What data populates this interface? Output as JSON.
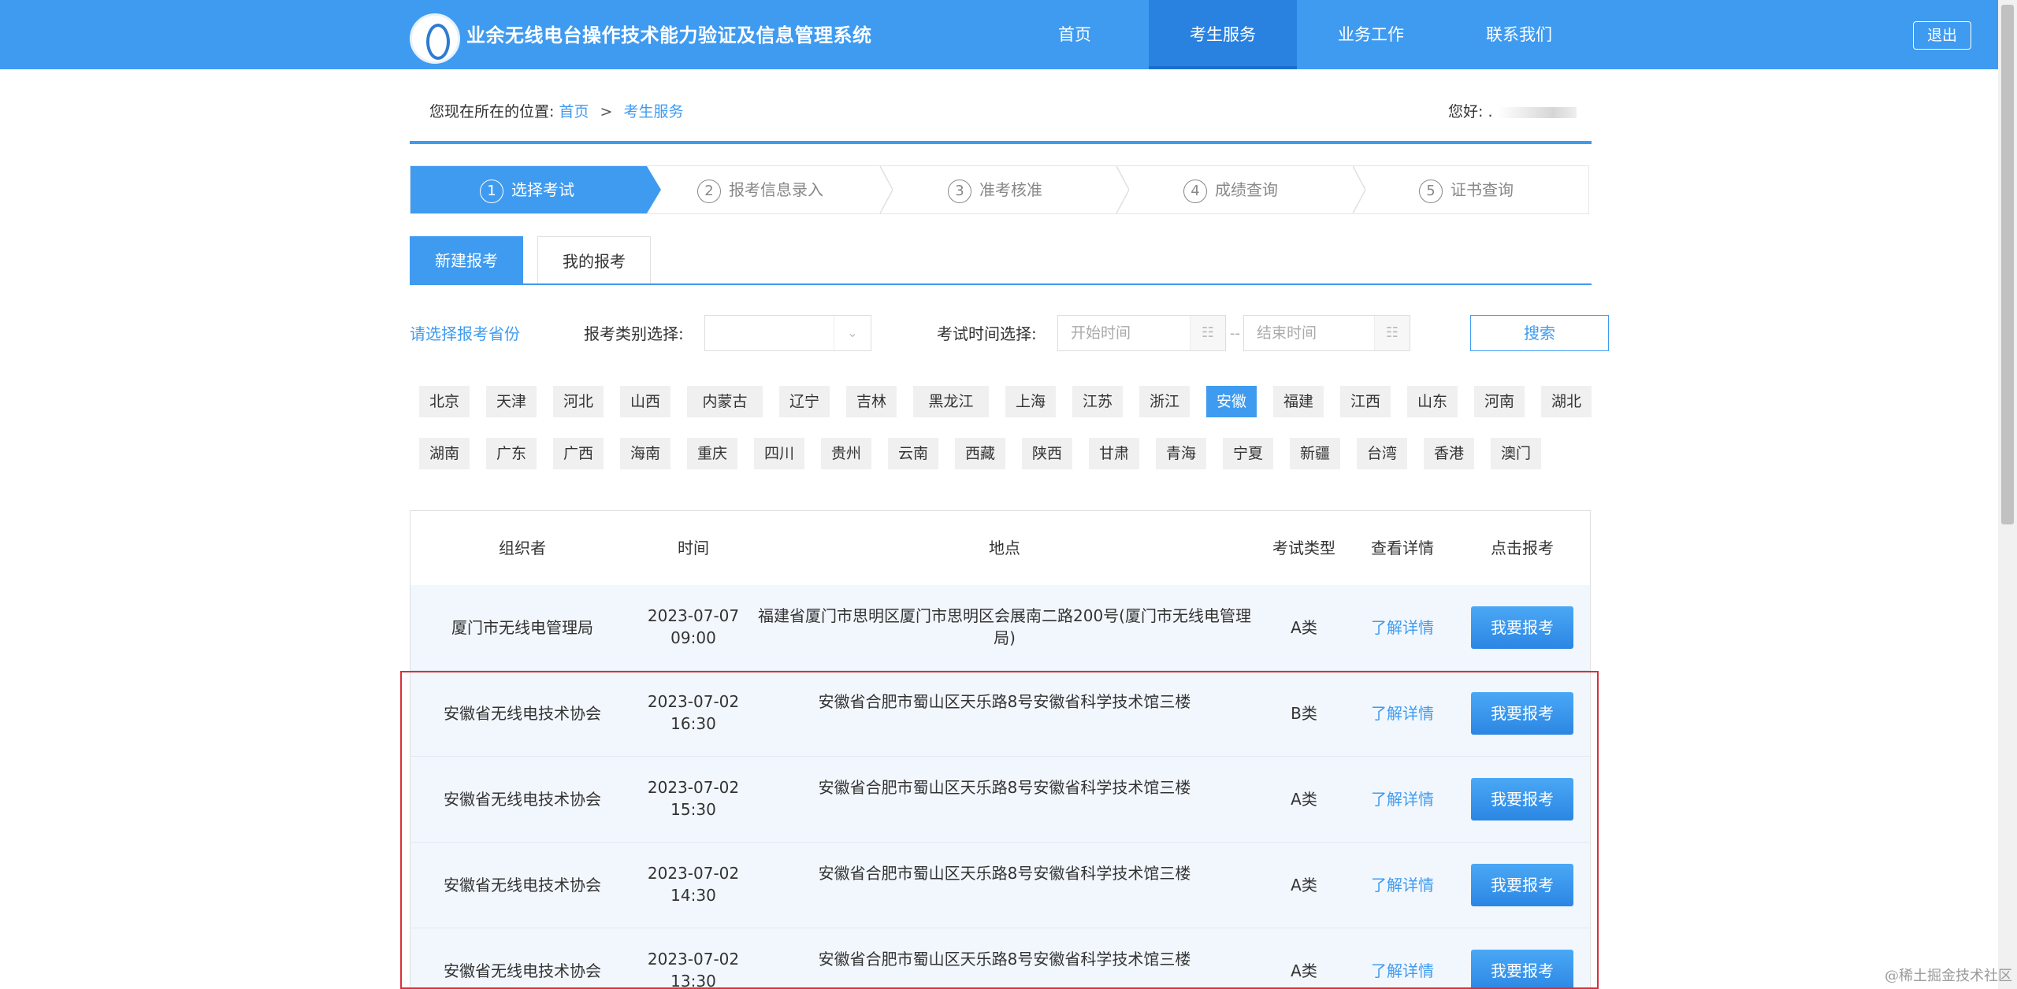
{
  "header": {
    "site_title": "业余无线电台操作技术能力验证及信息管理系统",
    "nav": [
      {
        "label": "首页",
        "active": false
      },
      {
        "label": "考生服务",
        "active": true
      },
      {
        "label": "业务工作",
        "active": false
      },
      {
        "label": "联系我们",
        "active": false
      }
    ],
    "logout_label": "退出"
  },
  "breadcrumb": {
    "prefix": "您现在所在的位置:",
    "home": "首页",
    "separator": ">",
    "current": "考生服务"
  },
  "greeting": {
    "label": "您好:",
    "user": "."
  },
  "steps": [
    {
      "num": "1",
      "label": "选择考试",
      "active": true
    },
    {
      "num": "2",
      "label": "报考信息录入",
      "active": false
    },
    {
      "num": "3",
      "label": "准考核准",
      "active": false
    },
    {
      "num": "4",
      "label": "成绩查询",
      "active": false
    },
    {
      "num": "5",
      "label": "证书查询",
      "active": false
    }
  ],
  "tabs": {
    "new": "新建报考",
    "mine": "我的报考"
  },
  "filters": {
    "province_prompt": "请选择报考省份",
    "category_label": "报考类别选择:",
    "category_value": "",
    "time_label": "考试时间选择:",
    "start_placeholder": "开始时间",
    "separator": "--",
    "end_placeholder": "结束时间",
    "search_label": "搜索"
  },
  "provinces": {
    "row1": [
      "北京",
      "天津",
      "河北",
      "山西",
      "内蒙古",
      "辽宁",
      "吉林",
      "黑龙江",
      "上海",
      "江苏",
      "浙江",
      "安徽",
      "福建",
      "江西",
      "山东",
      "河南",
      "湖北"
    ],
    "row2": [
      "湖南",
      "广东",
      "广西",
      "海南",
      "重庆",
      "四川",
      "贵州",
      "云南",
      "西藏",
      "陕西",
      "甘肃",
      "青海",
      "宁夏",
      "新疆",
      "台湾",
      "香港",
      "澳门"
    ],
    "active": "安徽"
  },
  "table": {
    "headers": [
      "组织者",
      "时间",
      "地点",
      "考试类型",
      "查看详情",
      "点击报考"
    ],
    "rows": [
      {
        "organizer": "厦门市无线电管理局",
        "date": "2023-07-07",
        "time": "09:00",
        "location_line1": "福建省厦门市思明区厦门市思明区会展南二路200号(厦门市无线电管理",
        "location_line2": "局)",
        "type": "A类",
        "detail": "了解详情",
        "apply": "我要报考"
      },
      {
        "organizer": "安徽省无线电技术协会",
        "date": "2023-07-02",
        "time": "16:30",
        "location_line1": "安徽省合肥市蜀山区天乐路8号安徽省科学技术馆三楼",
        "location_line2": "",
        "type": "B类",
        "detail": "了解详情",
        "apply": "我要报考"
      },
      {
        "organizer": "安徽省无线电技术协会",
        "date": "2023-07-02",
        "time": "15:30",
        "location_line1": "安徽省合肥市蜀山区天乐路8号安徽省科学技术馆三楼",
        "location_line2": "",
        "type": "A类",
        "detail": "了解详情",
        "apply": "我要报考"
      },
      {
        "organizer": "安徽省无线电技术协会",
        "date": "2023-07-02",
        "time": "14:30",
        "location_line1": "安徽省合肥市蜀山区天乐路8号安徽省科学技术馆三楼",
        "location_line2": "",
        "type": "A类",
        "detail": "了解详情",
        "apply": "我要报考"
      },
      {
        "organizer": "安徽省无线电技术协会",
        "date": "2023-07-02",
        "time": "13:30",
        "location_line1": "安徽省合肥市蜀山区天乐路8号安徽省科学技术馆三楼",
        "location_line2": "",
        "type": "A类",
        "detail": "了解详情",
        "apply": "我要报考"
      }
    ]
  },
  "watermark": "@稀土掘金技术社区",
  "colors": {
    "primary": "#3f9bf0",
    "highlight_frame": "#d9303a"
  }
}
